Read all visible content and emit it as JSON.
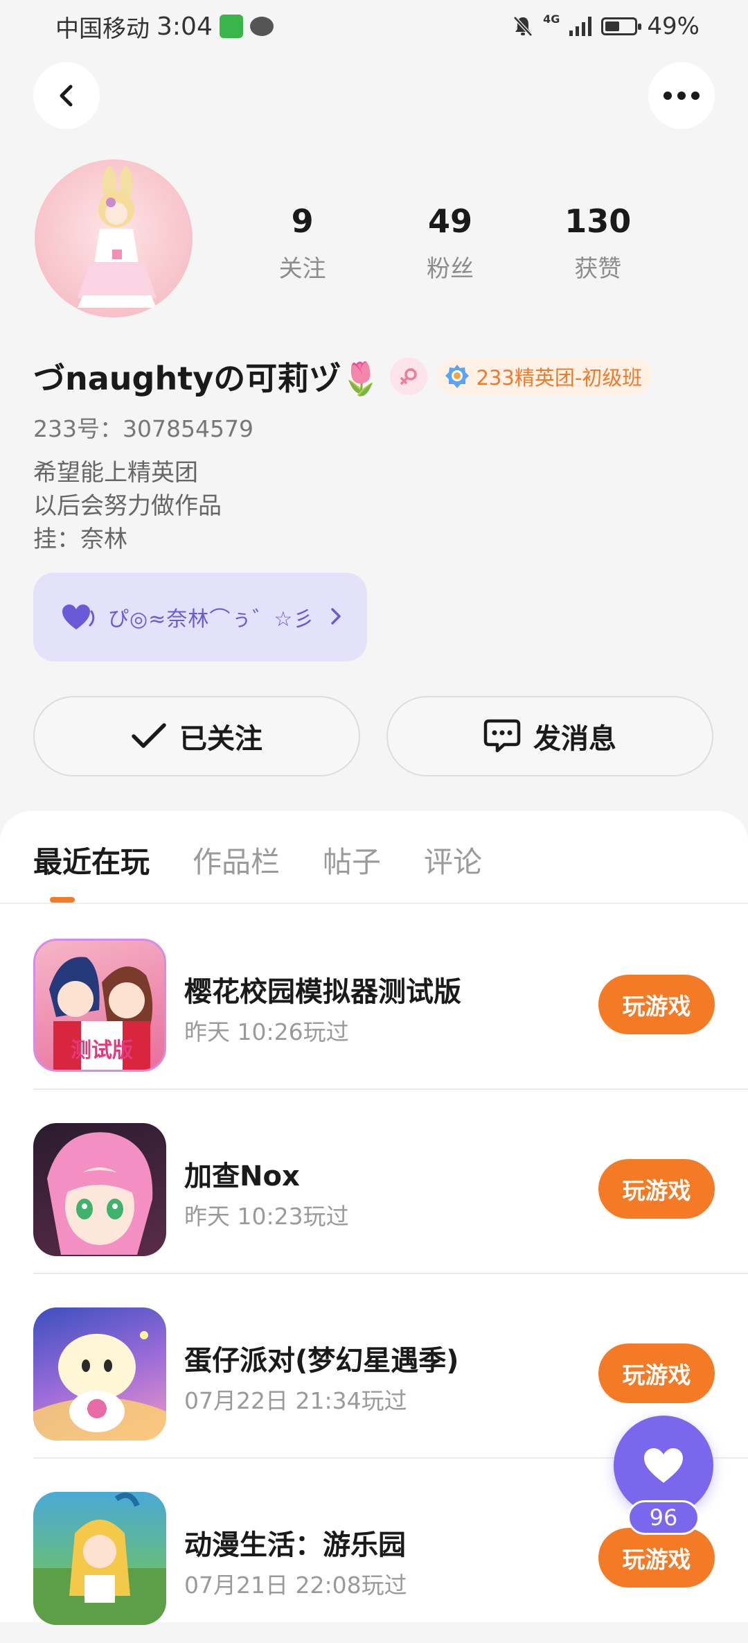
{
  "status_bar": {
    "carrier": "中国移动",
    "time": "3:04",
    "network": "4G",
    "battery": "49%",
    "battery_level": 0.49
  },
  "nav": {
    "back_icon": "chevron-left-icon",
    "more_icon": "more-horizontal-icon"
  },
  "profile": {
    "stats": [
      {
        "value": "9",
        "label": "关注"
      },
      {
        "value": "49",
        "label": "粉丝"
      },
      {
        "value": "130",
        "label": "获赞"
      }
    ],
    "username": "づnaughtyの可莉ヅ🌷",
    "badge": "233精英团-初级班",
    "uid": "233号：307854579",
    "bio": [
      "希望能上精英团",
      "以后会努力做作品",
      "挂：奈林"
    ],
    "fan_card_text": "ぴ◎≈奈林⌒ぅ゛☆彡",
    "follow_label": "已关注",
    "message_label": "发消息"
  },
  "tabs": [
    {
      "label": "最近在玩",
      "active": true
    },
    {
      "label": "作品栏",
      "active": false
    },
    {
      "label": "帖子",
      "active": false
    },
    {
      "label": "评论",
      "active": false
    }
  ],
  "games": [
    {
      "title": "樱花校园模拟器测试版",
      "time": "昨天 10:26玩过",
      "button": "玩游戏",
      "icon_text": "测试版"
    },
    {
      "title": "加查Nox",
      "time": "昨天 10:23玩过",
      "button": "玩游戏"
    },
    {
      "title": "蛋仔派对(梦幻星遇季)",
      "time": "07月22日 21:34玩过",
      "button": "玩游戏"
    },
    {
      "title": "动漫生活：游乐园",
      "time": "07月21日 22:08玩过",
      "button": "玩游戏"
    }
  ],
  "like_float": {
    "count": "96"
  },
  "colors": {
    "accent": "#f57a25",
    "purple": "#7a67ee",
    "badge_text": "#f07a2a"
  }
}
